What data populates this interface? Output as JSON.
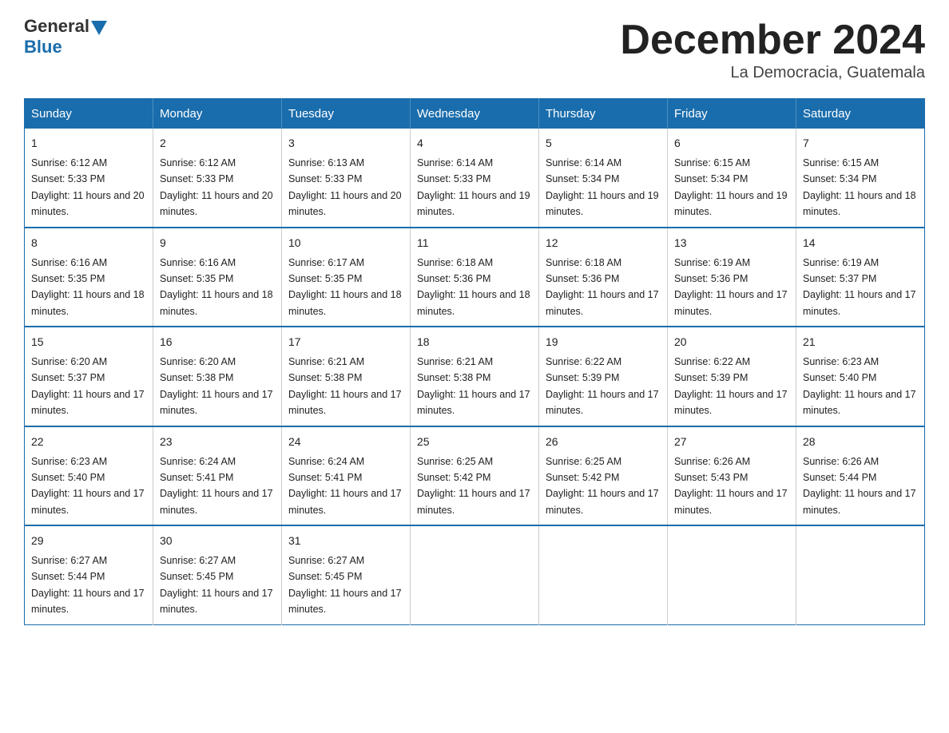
{
  "header": {
    "logo_general": "General",
    "logo_blue": "Blue",
    "month_title": "December 2024",
    "location": "La Democracia, Guatemala"
  },
  "calendar": {
    "days_of_week": [
      "Sunday",
      "Monday",
      "Tuesday",
      "Wednesday",
      "Thursday",
      "Friday",
      "Saturday"
    ],
    "weeks": [
      [
        {
          "day": "1",
          "sunrise": "6:12 AM",
          "sunset": "5:33 PM",
          "daylight": "11 hours and 20 minutes."
        },
        {
          "day": "2",
          "sunrise": "6:12 AM",
          "sunset": "5:33 PM",
          "daylight": "11 hours and 20 minutes."
        },
        {
          "day": "3",
          "sunrise": "6:13 AM",
          "sunset": "5:33 PM",
          "daylight": "11 hours and 20 minutes."
        },
        {
          "day": "4",
          "sunrise": "6:14 AM",
          "sunset": "5:33 PM",
          "daylight": "11 hours and 19 minutes."
        },
        {
          "day": "5",
          "sunrise": "6:14 AM",
          "sunset": "5:34 PM",
          "daylight": "11 hours and 19 minutes."
        },
        {
          "day": "6",
          "sunrise": "6:15 AM",
          "sunset": "5:34 PM",
          "daylight": "11 hours and 19 minutes."
        },
        {
          "day": "7",
          "sunrise": "6:15 AM",
          "sunset": "5:34 PM",
          "daylight": "11 hours and 18 minutes."
        }
      ],
      [
        {
          "day": "8",
          "sunrise": "6:16 AM",
          "sunset": "5:35 PM",
          "daylight": "11 hours and 18 minutes."
        },
        {
          "day": "9",
          "sunrise": "6:16 AM",
          "sunset": "5:35 PM",
          "daylight": "11 hours and 18 minutes."
        },
        {
          "day": "10",
          "sunrise": "6:17 AM",
          "sunset": "5:35 PM",
          "daylight": "11 hours and 18 minutes."
        },
        {
          "day": "11",
          "sunrise": "6:18 AM",
          "sunset": "5:36 PM",
          "daylight": "11 hours and 18 minutes."
        },
        {
          "day": "12",
          "sunrise": "6:18 AM",
          "sunset": "5:36 PM",
          "daylight": "11 hours and 17 minutes."
        },
        {
          "day": "13",
          "sunrise": "6:19 AM",
          "sunset": "5:36 PM",
          "daylight": "11 hours and 17 minutes."
        },
        {
          "day": "14",
          "sunrise": "6:19 AM",
          "sunset": "5:37 PM",
          "daylight": "11 hours and 17 minutes."
        }
      ],
      [
        {
          "day": "15",
          "sunrise": "6:20 AM",
          "sunset": "5:37 PM",
          "daylight": "11 hours and 17 minutes."
        },
        {
          "day": "16",
          "sunrise": "6:20 AM",
          "sunset": "5:38 PM",
          "daylight": "11 hours and 17 minutes."
        },
        {
          "day": "17",
          "sunrise": "6:21 AM",
          "sunset": "5:38 PM",
          "daylight": "11 hours and 17 minutes."
        },
        {
          "day": "18",
          "sunrise": "6:21 AM",
          "sunset": "5:38 PM",
          "daylight": "11 hours and 17 minutes."
        },
        {
          "day": "19",
          "sunrise": "6:22 AM",
          "sunset": "5:39 PM",
          "daylight": "11 hours and 17 minutes."
        },
        {
          "day": "20",
          "sunrise": "6:22 AM",
          "sunset": "5:39 PM",
          "daylight": "11 hours and 17 minutes."
        },
        {
          "day": "21",
          "sunrise": "6:23 AM",
          "sunset": "5:40 PM",
          "daylight": "11 hours and 17 minutes."
        }
      ],
      [
        {
          "day": "22",
          "sunrise": "6:23 AM",
          "sunset": "5:40 PM",
          "daylight": "11 hours and 17 minutes."
        },
        {
          "day": "23",
          "sunrise": "6:24 AM",
          "sunset": "5:41 PM",
          "daylight": "11 hours and 17 minutes."
        },
        {
          "day": "24",
          "sunrise": "6:24 AM",
          "sunset": "5:41 PM",
          "daylight": "11 hours and 17 minutes."
        },
        {
          "day": "25",
          "sunrise": "6:25 AM",
          "sunset": "5:42 PM",
          "daylight": "11 hours and 17 minutes."
        },
        {
          "day": "26",
          "sunrise": "6:25 AM",
          "sunset": "5:42 PM",
          "daylight": "11 hours and 17 minutes."
        },
        {
          "day": "27",
          "sunrise": "6:26 AM",
          "sunset": "5:43 PM",
          "daylight": "11 hours and 17 minutes."
        },
        {
          "day": "28",
          "sunrise": "6:26 AM",
          "sunset": "5:44 PM",
          "daylight": "11 hours and 17 minutes."
        }
      ],
      [
        {
          "day": "29",
          "sunrise": "6:27 AM",
          "sunset": "5:44 PM",
          "daylight": "11 hours and 17 minutes."
        },
        {
          "day": "30",
          "sunrise": "6:27 AM",
          "sunset": "5:45 PM",
          "daylight": "11 hours and 17 minutes."
        },
        {
          "day": "31",
          "sunrise": "6:27 AM",
          "sunset": "5:45 PM",
          "daylight": "11 hours and 17 minutes."
        },
        null,
        null,
        null,
        null
      ]
    ]
  }
}
